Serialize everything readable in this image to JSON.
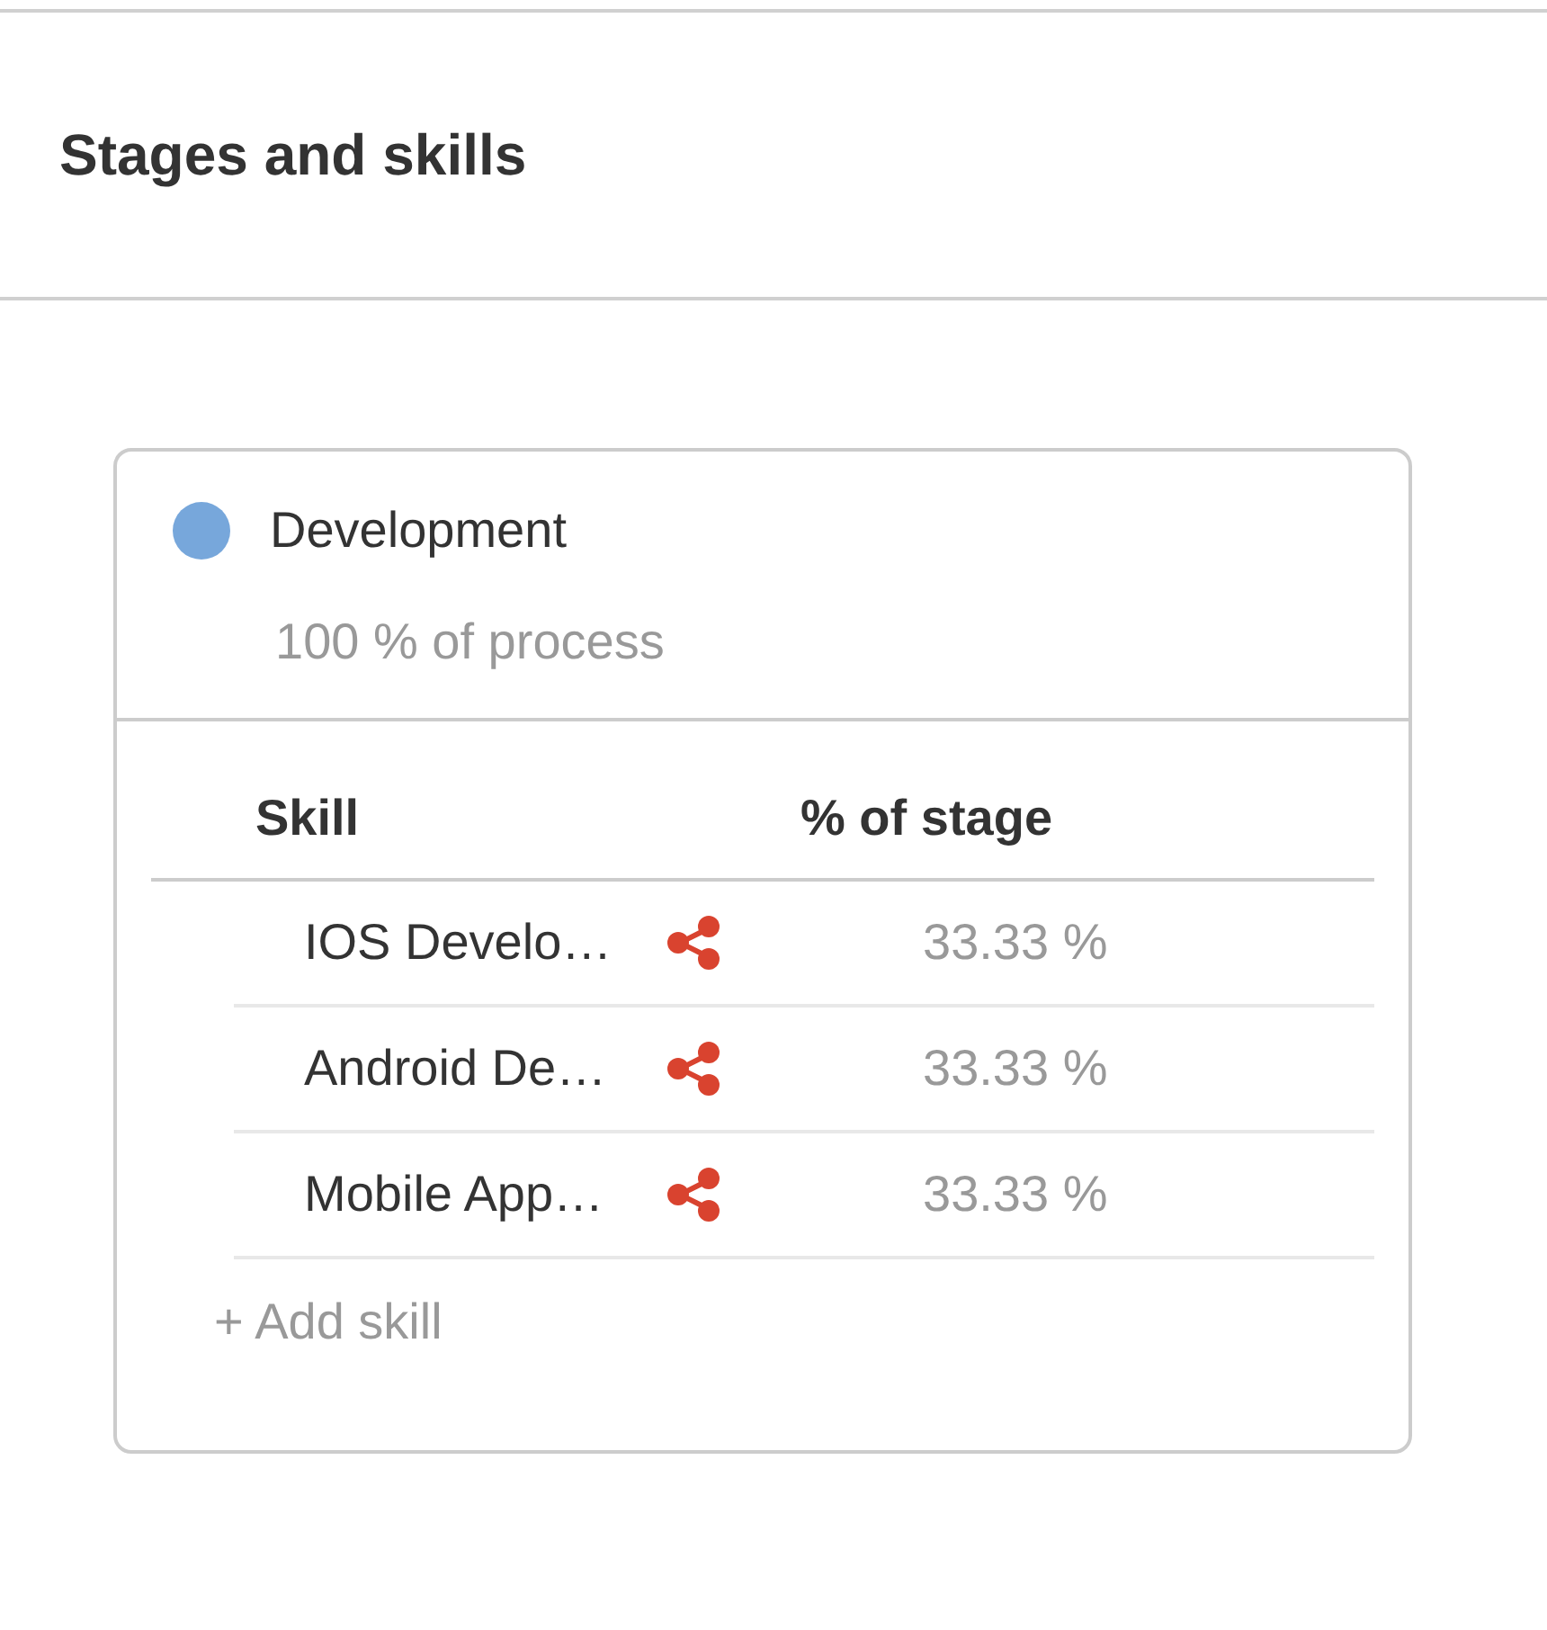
{
  "header": {
    "title": "Stages and skills"
  },
  "stages": [
    {
      "name": "Development",
      "color": "#77a7db",
      "share": "100 % of process",
      "table": {
        "columns": [
          "Skill",
          "% of stage"
        ],
        "rows": [
          {
            "skill": "IOS Develo…",
            "percent": "33.33 %"
          },
          {
            "skill": "Android De…",
            "percent": "33.33 %"
          },
          {
            "skill": "Mobile App…",
            "percent": "33.33 %"
          }
        ]
      },
      "add_button": "+ Add skill"
    }
  ]
}
